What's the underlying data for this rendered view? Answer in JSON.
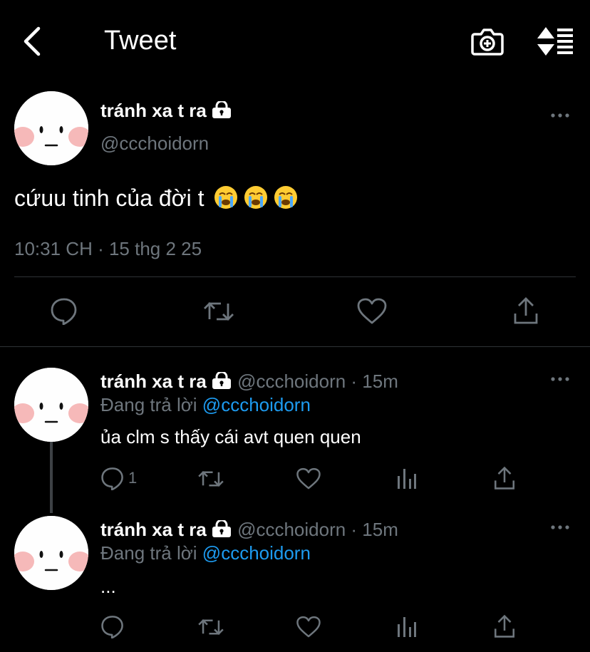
{
  "header": {
    "title": "Tweet"
  },
  "tweet": {
    "display_name": "tránh xa t ra",
    "handle": "@ccchoidorn",
    "text": "cứuu tinh của đời t",
    "emoji": "😭😭😭",
    "timestamp": "10:31 CH · 15 thg 2 25"
  },
  "replies": [
    {
      "display_name": "tránh xa t ra",
      "meta": "@ccchoidorn · 15m",
      "replying_label": "Đang trả lời",
      "replying_to": "@ccchoidorn",
      "text": "ủa clm s thấy cái avt quen quen",
      "reply_count": "1"
    },
    {
      "display_name": "tránh xa t ra",
      "meta": "@ccchoidorn · 15m",
      "replying_label": "Đang trả lời",
      "replying_to": "@ccchoidorn",
      "text": "...",
      "reply_count": ""
    }
  ],
  "colors": {
    "background": "#000000",
    "text": "#ffffff",
    "muted": "#6e767d",
    "link": "#1d9bf0",
    "divider": "#2f3336",
    "avatar_blush": "#f6b9b9"
  },
  "icons": [
    "back-arrow-icon",
    "camera-plus-icon",
    "sort-icon",
    "lock-icon",
    "more-icon",
    "reply-icon",
    "retweet-icon",
    "like-icon",
    "analytics-icon",
    "share-icon"
  ]
}
